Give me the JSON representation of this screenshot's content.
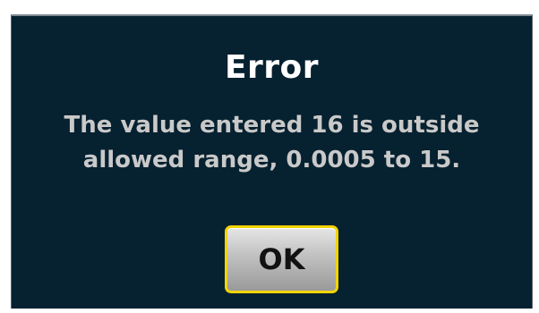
{
  "dialog": {
    "title": "Error",
    "message_line1": "The value entered 16 is outside",
    "message_line2": "allowed range, 0.0005 to 15.",
    "ok_label": "OK"
  },
  "colors": {
    "dialog_background": "#062130",
    "title_text": "#ffffff",
    "message_text": "#c9c9c9",
    "button_border": "#f2d400"
  }
}
